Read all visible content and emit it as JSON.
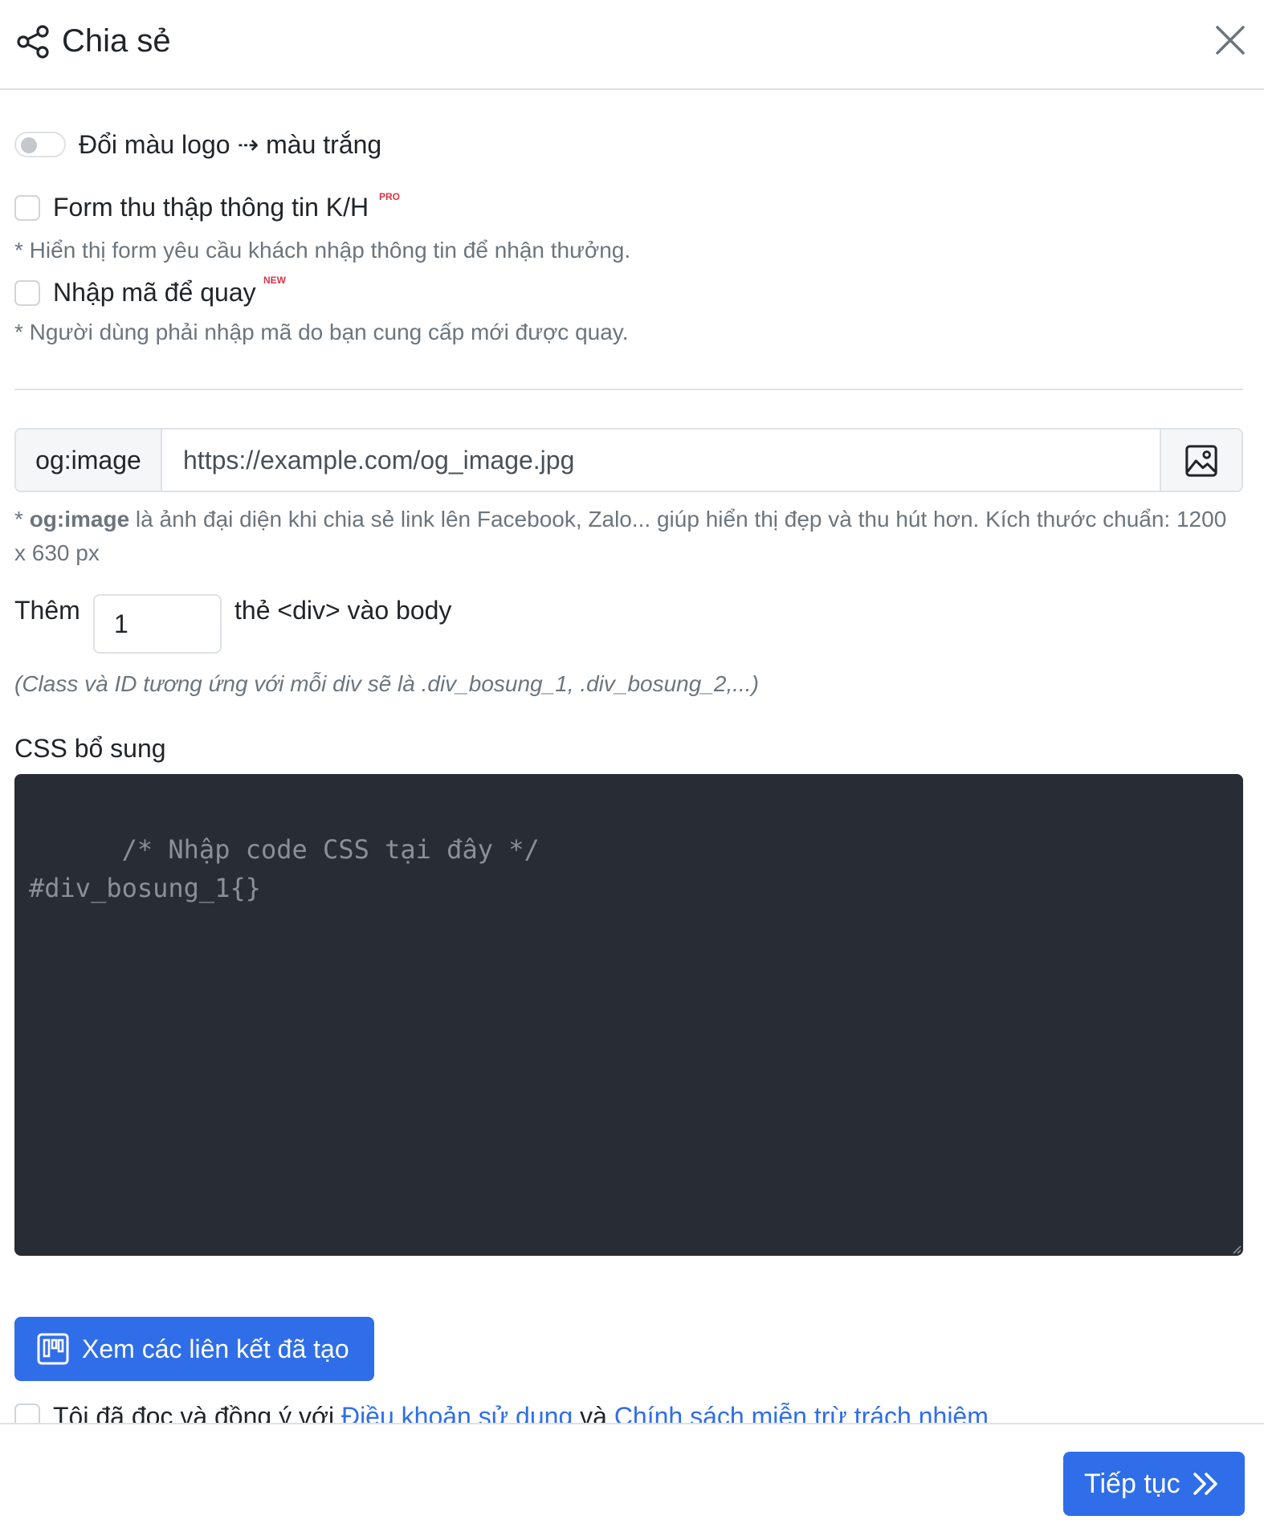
{
  "header": {
    "title": "Chia sẻ"
  },
  "options": {
    "logo_switch_label": "Đổi màu logo ⇢ màu trắng",
    "form_label": "Form thu thập thông tin K/H",
    "form_badge": "PRO",
    "form_hint": "* Hiển thị form yêu cầu khách nhập thông tin để nhận thưởng.",
    "code_label": "Nhập mã để quay",
    "code_badge": "NEW",
    "code_hint": "* Người dùng phải nhập mã do bạn cung cấp mới được quay."
  },
  "og_image": {
    "prefix": "og:image",
    "value": "https://example.com/og_image.jpg",
    "hint_bold": "og:image",
    "hint_text": " là ảnh đại diện khi chia sẻ link lên Facebook, Zalo... giúp hiển thị đẹp và thu hút hơn. Kích thước chuẩn: 1200 x 630 px"
  },
  "div_tags": {
    "pre": "Thêm",
    "value": "1",
    "post": "thẻ <div> vào body",
    "hint": "(Class và ID tương ứng với mỗi div sẽ là .div_bosung_1, .div_bosung_2,...)"
  },
  "css": {
    "label": "CSS bổ sung",
    "placeholder": "/* Nhập code CSS tại đây */\n#div_bosung_1{}"
  },
  "links_button": "Xem các liên kết đã tạo",
  "agreement": {
    "prefix": "Tôi đã đọc và đồng ý với ",
    "terms_link": "Điều khoản sử dụng",
    "and": " và ",
    "policy_link": "Chính sách miễn trừ trách nhiệm"
  },
  "footer": {
    "next_button": "Tiếp tục"
  },
  "colors": {
    "primary": "#2f6ee8",
    "badge": "#dc3545",
    "editor_bg": "#282c34"
  }
}
